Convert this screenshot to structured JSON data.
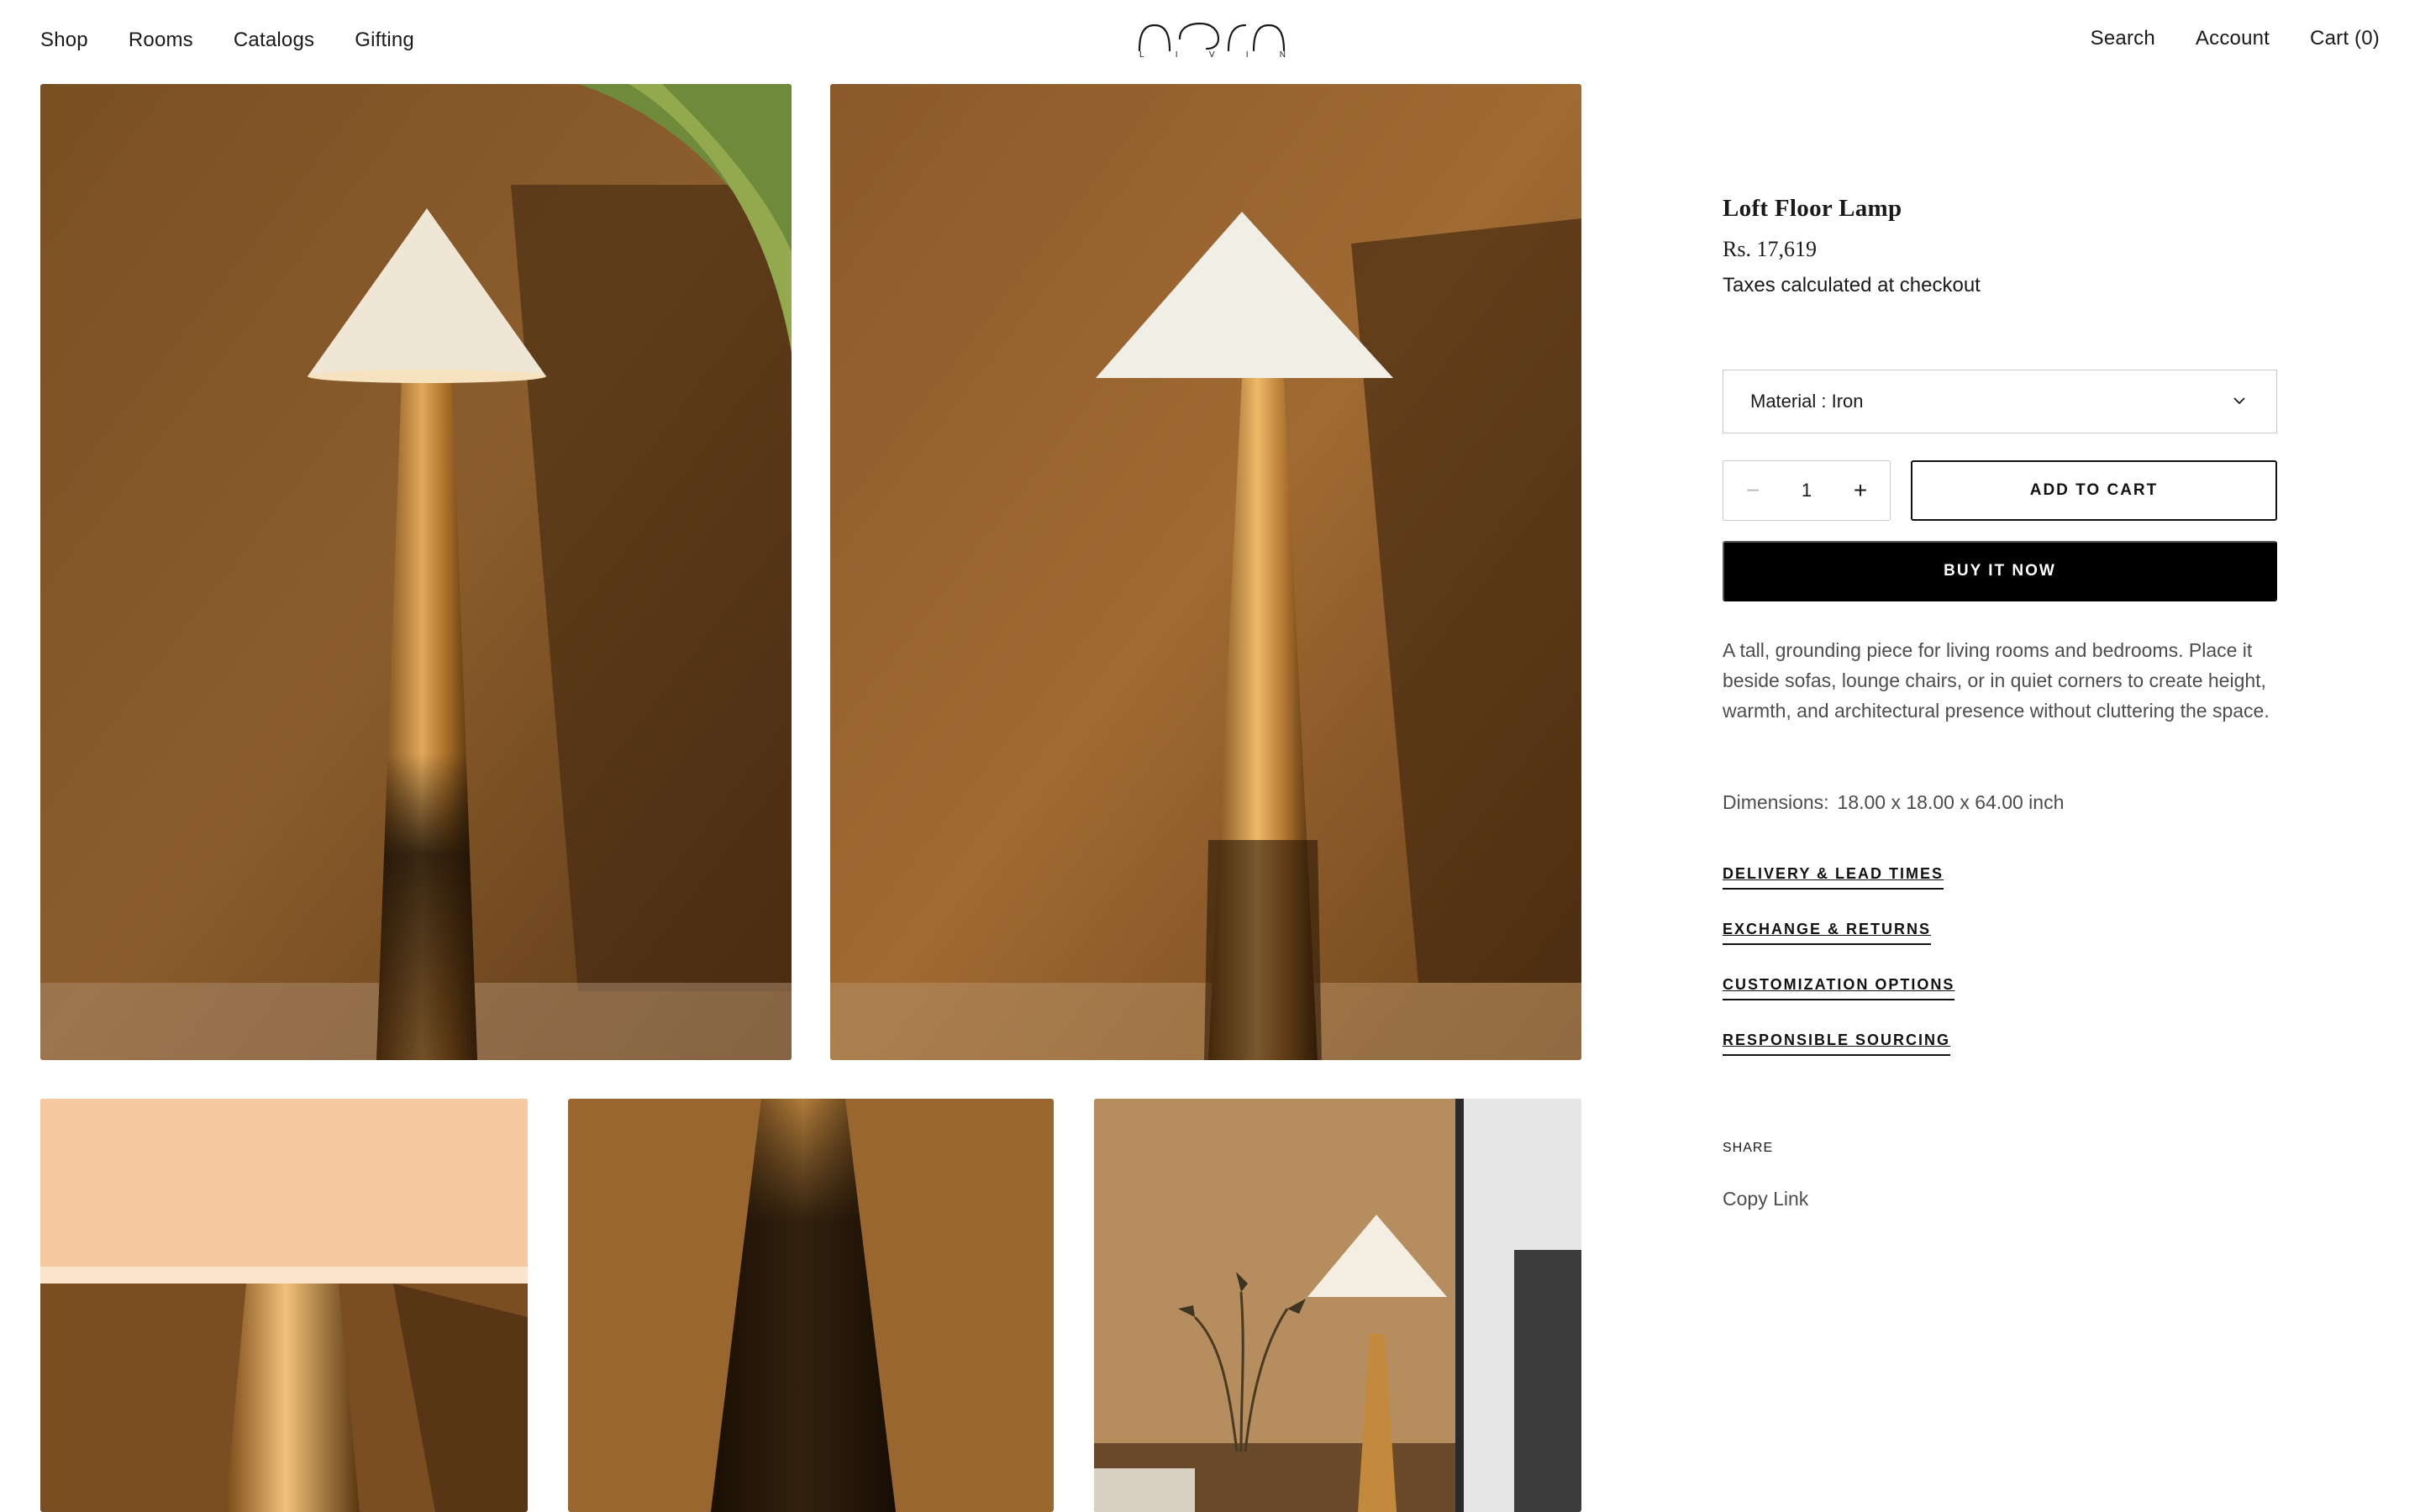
{
  "header": {
    "nav_left": [
      "Shop",
      "Rooms",
      "Catalogs",
      "Gifting"
    ],
    "logo_letters": [
      "L",
      "I",
      "V",
      "I",
      "N"
    ],
    "nav_right": {
      "search": "Search",
      "account": "Account",
      "cart": "Cart (0)"
    }
  },
  "gallery": {
    "images": [
      "lamp-front-image",
      "lamp-side-image",
      "lamp-shade-closeup-image",
      "lamp-base-closeup-image",
      "lamp-room-image"
    ]
  },
  "product": {
    "title": "Loft Floor Lamp",
    "price": "Rs. 17,619",
    "tax_note": "Taxes calculated at checkout",
    "variant_select": "Material : Iron",
    "quantity": "1",
    "add_to_cart": "ADD TO CART",
    "buy_now": "BUY IT NOW",
    "description": "A tall, grounding piece for living rooms and bedrooms. Place it beside sofas, lounge chairs, or in quiet corners to create height, warmth, and architectural presence without cluttering the space.",
    "dimensions_label": "Dimensions:",
    "dimensions_value": "18.00 x 18.00 x 64.00 inch",
    "accordions": [
      "DELIVERY & LEAD TIMES",
      "EXCHANGE & RETURNS",
      "CUSTOMIZATION OPTIONS",
      "RESPONSIBLE SOURCING"
    ],
    "share_label": "SHARE",
    "copy_link": "Copy Link"
  },
  "colors": {
    "accent": "#000000",
    "text": "#1a1a1a",
    "muted_text": "#4d4d4d",
    "border": "#c9c9c9"
  }
}
